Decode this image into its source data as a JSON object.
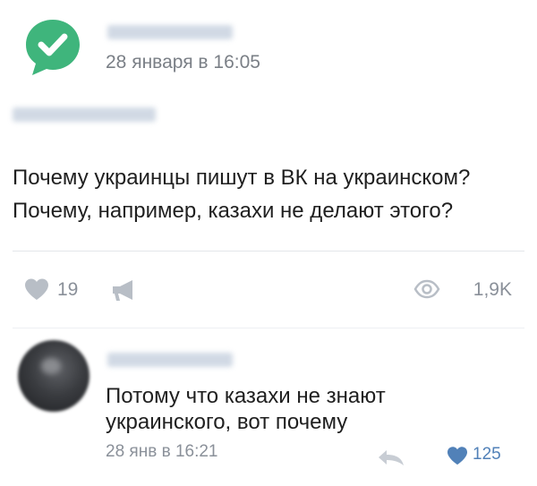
{
  "post": {
    "author": "Kdnoi Pragma",
    "date": "28 января в 16:05",
    "source": "#other@kdnoi",
    "text_lines": [
      "Почему украинцы пишут в ВК на украинском?",
      "Почему, например, казахи не делают этого?"
    ],
    "likes": "19",
    "views": "1,9K",
    "avatar_icon": "check-mark-speech-bubble-icon",
    "avatar_color": "#3fb57c"
  },
  "comment": {
    "author": "Art Samura",
    "text_lines": [
      "Потому что казахи не знают",
      "украинского, вот почему"
    ],
    "date": "28 янв в 16:21",
    "likes": "125",
    "like_color": "#5181b8"
  },
  "colors": {
    "muted_icon": "#b8bec6",
    "muted_text": "#8a9099",
    "accent": "#5181b8"
  }
}
